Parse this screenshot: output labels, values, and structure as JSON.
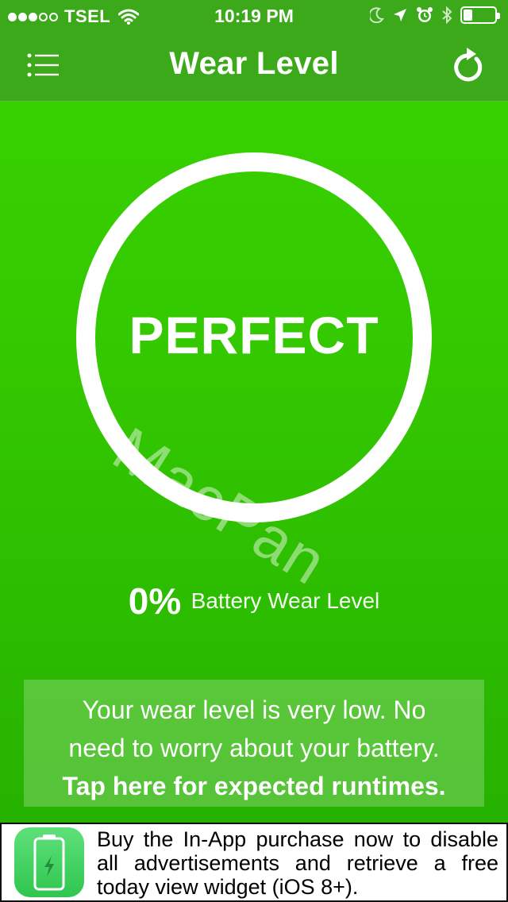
{
  "status_bar": {
    "carrier": "TSEL",
    "time": "10:19 PM",
    "signal_bars": 3,
    "signal_total": 5,
    "battery_level": 0.3,
    "icons": [
      "wifi-icon",
      "moon-icon",
      "location-arrow-icon",
      "alarm-icon",
      "bluetooth-icon",
      "battery-icon"
    ]
  },
  "nav": {
    "title": "Wear Level",
    "left_icon": "list-menu-icon",
    "right_icon": "refresh-icon"
  },
  "gauge": {
    "label": "PERFECT"
  },
  "watermark": "MacPan",
  "wear": {
    "percent": "0%",
    "caption": "Battery Wear Level"
  },
  "info": {
    "line1": "Your wear level is very low. No",
    "line2": "need to worry about your battery.",
    "link": "Tap here for expected runtimes."
  },
  "ad": {
    "text": "Buy the In-App purchase now to disable all advertisements and retrieve a free today view widget (iOS 8+).",
    "icon": "battery-app-icon"
  },
  "colors": {
    "background_top": "#38d400",
    "background_bottom": "#24ad00",
    "nav_bar": "#3ca91b",
    "ad_icon": "#2fc64f"
  }
}
